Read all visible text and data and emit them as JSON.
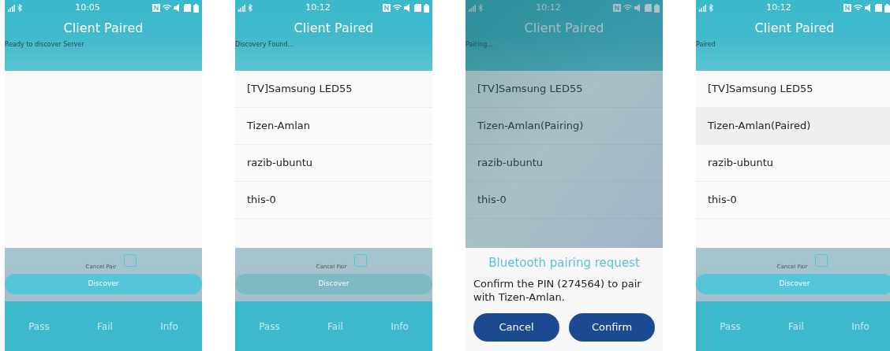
{
  "screens": [
    {
      "time": "10:05",
      "title": "Client Paired",
      "status_text": "Ready to discover Server",
      "dimmed": false,
      "cancel_pair": {
        "label": "Cancel Pair",
        "checked": false
      },
      "discover": {
        "label": "Discover",
        "disabled": false
      },
      "tabs": [
        "Pass",
        "Fail",
        "Info"
      ]
    },
    {
      "time": "10:12",
      "title": "Client Paired",
      "status_text": "Discovery Found...",
      "dimmed": false,
      "devices": [
        {
          "name": "[TV]Samsung LED55",
          "selected": false
        },
        {
          "name": "Tizen-Amlan",
          "selected": false
        },
        {
          "name": "razib-ubuntu",
          "selected": false
        },
        {
          "name": "this-0",
          "selected": false
        }
      ],
      "cancel_pair": {
        "label": "Cancel Pair",
        "checked": false
      },
      "discover": {
        "label": "Discover",
        "disabled": true
      },
      "tabs": [
        "Pass",
        "Fail",
        "Info"
      ]
    },
    {
      "time": "10:12",
      "title": "Client Paired",
      "status_text": "Pairing...",
      "dimmed": true,
      "devices": [
        {
          "name": "[TV]Samsung LED55"
        },
        {
          "name": "Tizen-Amlan(Pairing)"
        },
        {
          "name": "razib-ubuntu"
        },
        {
          "name": "this-0"
        }
      ],
      "dialog": {
        "title": "Bluetooth pairing request",
        "message": "Confirm the PIN (274564) to pair with Tizen-Amlan.",
        "buttons": [
          "Cancel",
          "Confirm"
        ]
      }
    },
    {
      "time": "10:12",
      "title": "Client Paired",
      "status_text": "Paired",
      "dimmed": false,
      "devices": [
        {
          "name": "[TV]Samsung LED55",
          "selected": false
        },
        {
          "name": "Tizen-Amlan(Paired)",
          "selected": true
        },
        {
          "name": "razib-ubuntu",
          "selected": false
        },
        {
          "name": "this-0",
          "selected": false
        }
      ],
      "cancel_pair": {
        "label": "Cancel Pair",
        "checked": false
      },
      "discover": {
        "label": "Discover",
        "disabled": false
      },
      "tabs": [
        "Pass",
        "Fail",
        "Info"
      ]
    }
  ]
}
